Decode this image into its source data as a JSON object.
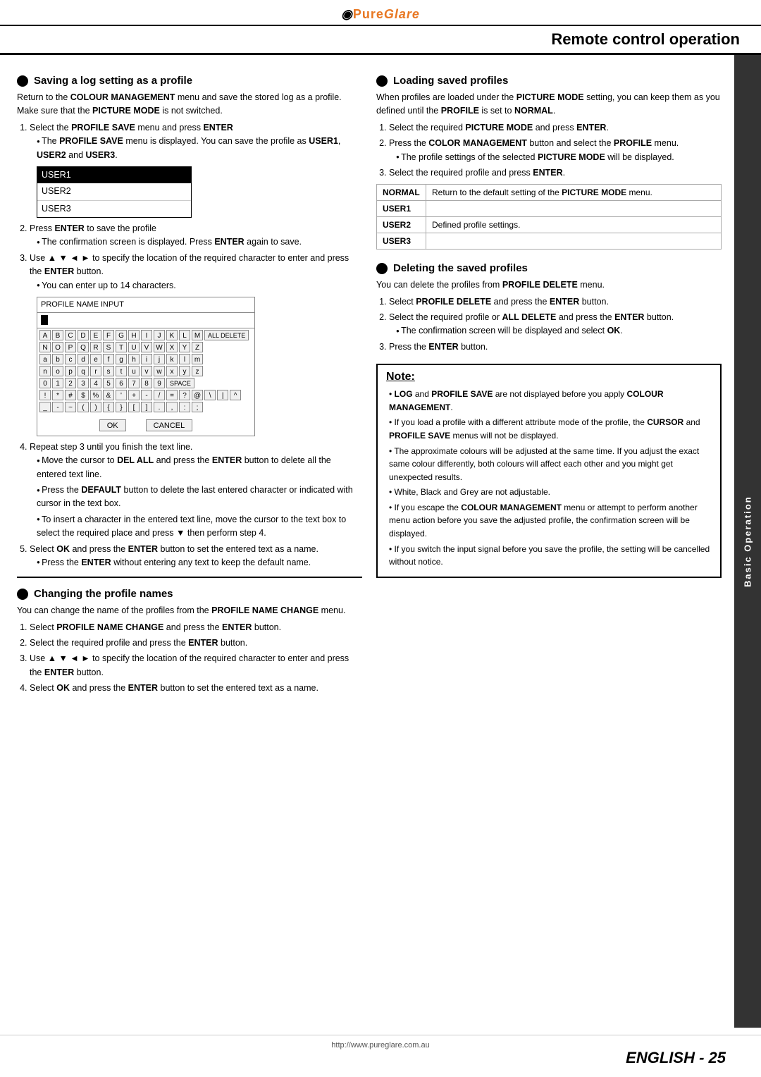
{
  "header": {
    "logo": "PureGlare",
    "page_title": "Remote control operation"
  },
  "sidebar": {
    "label": "Basic Operation"
  },
  "left_col": {
    "saving_section": {
      "heading": "Saving a log setting as a profile",
      "intro": "Return to the ",
      "intro_bold": "COLOUR MANAGEMENT",
      "intro2": " menu and save the stored log as a profile. Make sure that the ",
      "intro_bold2": "PICTURE MODE",
      "intro3": " is not switched.",
      "steps": [
        {
          "text": "Select the ",
          "bold": "PROFILE SAVE",
          "text2": " menu and press ",
          "bold2": "ENTER"
        }
      ],
      "profile_save_note": "The ",
      "profile_save_bold": "PROFILE SAVE",
      "profile_save_note2": " menu is displayed. You can save the profile as ",
      "profile_save_bold2": "USER1",
      "profile_save_note3": ", ",
      "profile_save_bold3": "USER2",
      "profile_save_note4": " and ",
      "profile_save_bold4": "USER3",
      "users": [
        "USER1",
        "USER2",
        "USER3"
      ],
      "step2": "Press ",
      "step2_bold": "ENTER",
      "step2_text": " to save the profile",
      "step2_sub": "The confirmation screen is displayed. Press ",
      "step2_sub_bold": "ENTER",
      "step2_sub2": " again to save.",
      "step3_text": "Use ▲ ▼ ◄ ► to specify the location of the required character to enter and press the ",
      "step3_bold": "ENTER",
      "step3_text2": " button.",
      "step3_sub": "You can enter up to 14 characters.",
      "keyboard_title": "PROFILE NAME INPUT",
      "keyboard_rows": [
        [
          "A",
          "B",
          "C",
          "D",
          "E",
          "F",
          "G",
          "H",
          "I",
          "J",
          "K",
          "L",
          "M"
        ],
        [
          "N",
          "O",
          "P",
          "Q",
          "R",
          "S",
          "T",
          "U",
          "V",
          "W",
          "X",
          "Y",
          "Z"
        ],
        [
          "a",
          "b",
          "c",
          "d",
          "e",
          "f",
          "g",
          "h",
          "i",
          "j",
          "k",
          "l",
          "m"
        ],
        [
          "n",
          "o",
          "p",
          "q",
          "r",
          "s",
          "t",
          "u",
          "v",
          "w",
          "x",
          "y",
          "z"
        ],
        [
          "0",
          "1",
          "2",
          "3",
          "4",
          "5",
          "6",
          "7",
          "8",
          "9",
          "SPACE"
        ],
        [
          "!",
          "*",
          "#",
          "$",
          "%",
          "&",
          "'",
          "*",
          "+",
          " -",
          " /",
          " =",
          " ?",
          "@",
          "\\",
          "|",
          "^"
        ],
        [
          "_",
          "-",
          "~",
          "(",
          ")",
          "{",
          "}",
          "[",
          "]",
          ".",
          ",",
          ":",
          " ;"
        ]
      ],
      "all_delete_label": "ALL DELETE",
      "ok_label": "OK",
      "cancel_label": "CANCEL",
      "step4": "Repeat step 3 until you finish the text line.",
      "step4_subs": [
        "Move the cursor to DEL ALL and press the ENTER button to delete all the entered text line.",
        "Press the DEFAULT button to delete the last entered character or indicated with cursor in the text box.",
        "To insert a character in the entered text line, move the cursor to the text box to select the required place and press ▼ then perform step 4."
      ],
      "step5": "Select ",
      "step5_bold": "OK",
      "step5_text": " and press the ",
      "step5_bold2": "ENTER",
      "step5_text2": " button to set the entered text as a name.",
      "step5_sub": "Press the ",
      "step5_sub_bold": "ENTER",
      "step5_sub2": " without entering any text to keep the default name."
    },
    "changing_section": {
      "heading": "Changing the profile names",
      "intro": "You can change the name of the profiles from the ",
      "intro_bold": "PROFILE NAME CHANGE",
      "intro2": " menu.",
      "steps": [
        {
          "text": "Select ",
          "bold": "PROFILE NAME CHANGE",
          "text2": " and press the ",
          "bold2": "ENTER",
          "text3": " button."
        },
        {
          "text": "Select the required profile and press the ",
          "bold": "ENTER",
          "text2": " button."
        },
        {
          "text": "Use ▲ ▼ ◄ ► to specify the location of the required character to enter and press the ",
          "bold": "ENTER",
          "text2": " button."
        },
        {
          "text": "Select ",
          "bold": "OK",
          "text2": " and press the ",
          "bold2": "ENTER",
          "text3": " button to set the entered text as a name."
        }
      ]
    }
  },
  "right_col": {
    "loading_section": {
      "heading": "Loading saved profiles",
      "intro": "When profiles are loaded under the ",
      "intro_bold": "PICTURE MODE",
      "intro2": " setting, you can keep them as you defined until the ",
      "intro_bold2": "PROFILE",
      "intro3": " is set to ",
      "intro_bold3": "NORMAL",
      "intro4": ".",
      "steps": [
        {
          "text": "Select the required ",
          "bold": "PICTURE MODE",
          "text2": " and press ",
          "bold2": "ENTER",
          "text3": "."
        },
        {
          "text": "Press the ",
          "bold": "COLOR MANAGEMENT",
          "text2": " button and select the ",
          "bold2": "PROFILE",
          "text3": " menu.",
          "sub": "The profile settings of the selected PICTURE MODE will be displayed."
        },
        {
          "text": "Select the required profile and press ",
          "bold": "ENTER",
          "text2": "."
        }
      ],
      "profile_table": [
        {
          "label": "NORMAL",
          "desc": "Return to the default setting of the PICTURE MODE menu."
        },
        {
          "label": "USER1",
          "desc": ""
        },
        {
          "label": "USER2",
          "desc": "Defined profile settings."
        },
        {
          "label": "USER3",
          "desc": ""
        }
      ]
    },
    "deleting_section": {
      "heading": "Deleting the saved profiles",
      "intro": "You can delete the profiles from ",
      "intro_bold": "PROFILE DELETE",
      "intro2": " menu.",
      "steps": [
        {
          "text": "Select ",
          "bold": "PROFILE DELETE",
          "text2": " and press the ",
          "bold2": "ENTER",
          "text3": " button."
        },
        {
          "text": "Select the required profile or ",
          "bold": "ALL DELETE",
          "text2": " and press the ",
          "bold2": "ENTER",
          "text3": " button.",
          "sub": "The confirmation screen will be displayed and select OK."
        },
        {
          "text": "Press the ",
          "bold": "ENTER",
          "text2": " button."
        }
      ]
    },
    "note": {
      "title": "Note:",
      "items": [
        "LOG and PROFILE SAVE are not displayed before you apply COLOUR MANAGEMENT.",
        "If you load a profile with a different attribute mode of the profile, the CURSOR and PROFILE SAVE menus will not be displayed.",
        "The approximate colours will be adjusted at the same time. If you adjust the exact same colour differently, both colours will affect each other and you might get unexpected results.",
        "White, Black and Grey are not adjustable.",
        "If you escape the COLOUR MANAGEMENT menu or attempt to perform another menu action before you save the adjusted profile, the confirmation screen will be displayed.",
        "If you switch the input signal before you save the profile, the setting will be cancelled without notice."
      ]
    }
  },
  "footer": {
    "url": "http://www.pureglare.com.au"
  },
  "page_number": {
    "prefix": "E",
    "suffix": "NGLISH - 25"
  }
}
